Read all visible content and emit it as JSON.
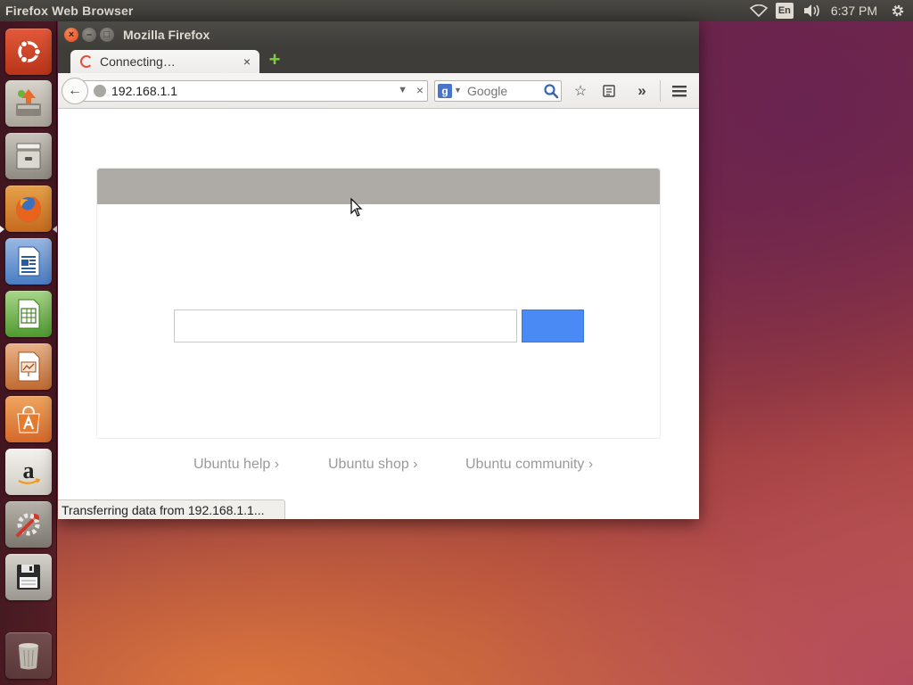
{
  "top_panel": {
    "app_title": "Firefox Web Browser",
    "language": "En",
    "clock": "6:37 PM"
  },
  "launcher": {
    "items": [
      {
        "name": "ubuntu-dash",
        "icon": "ubuntu-logo-icon"
      },
      {
        "name": "software-updater",
        "icon": "software-updater-icon"
      },
      {
        "name": "files",
        "icon": "file-cabinet-icon"
      },
      {
        "name": "firefox",
        "icon": "firefox-icon",
        "active": true
      },
      {
        "name": "libreoffice-writer",
        "icon": "writer-document-icon"
      },
      {
        "name": "libreoffice-calc",
        "icon": "calc-spreadsheet-icon"
      },
      {
        "name": "libreoffice-impress",
        "icon": "impress-presentation-icon"
      },
      {
        "name": "ubuntu-software-center",
        "icon": "software-center-bag-icon"
      },
      {
        "name": "amazon",
        "icon": "amazon-icon"
      },
      {
        "name": "system-settings",
        "icon": "settings-wrench-icon"
      },
      {
        "name": "save-disk",
        "icon": "floppy-disk-icon"
      },
      {
        "name": "trash",
        "icon": "trash-icon"
      }
    ]
  },
  "window": {
    "title": "Mozilla Firefox",
    "close_glyph": "×",
    "min_glyph": "–",
    "max_glyph": "□"
  },
  "tab": {
    "title": "Connecting…",
    "close_glyph": "×",
    "new_tab_glyph": "+"
  },
  "navbar": {
    "back_glyph": "←",
    "url": "192.168.1.1",
    "url_dropdown_glyph": "▼",
    "url_clear_glyph": "×",
    "search_engine": "g",
    "search_dropdown_glyph": "▼",
    "search_placeholder": "Google",
    "bookmark_glyph": "☆",
    "overflow_glyph": "»"
  },
  "page": {
    "links": [
      "Ubuntu help ›",
      "Ubuntu shop ›",
      "Ubuntu community ›"
    ]
  },
  "status": {
    "text": "Transferring data from 192.168.1.1..."
  },
  "colors": {
    "accent_button": "#4a8af4",
    "panel_bg": "#3b3a36",
    "card_header": "#aeaaa6",
    "close_button": "#e0481c"
  }
}
